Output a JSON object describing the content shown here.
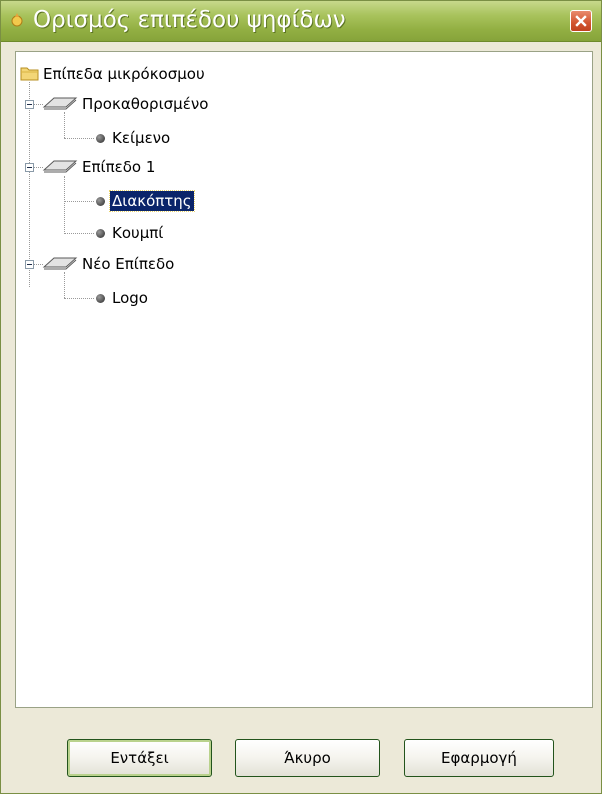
{
  "window": {
    "title": "Ορισμός επιπέδου ψηφίδων",
    "accent": "#93b043"
  },
  "tree": {
    "root": {
      "label": "Επίπεδα μικρόκοσμου",
      "icon": "folder-icon"
    },
    "layers": [
      {
        "label": "Προκαθορισμένο",
        "icon": "layer-icon",
        "expanded": true,
        "children": [
          {
            "label": "Κείμενο"
          }
        ]
      },
      {
        "label": "Επίπεδο 1",
        "icon": "layer-icon",
        "expanded": true,
        "children": [
          {
            "label": "Διακόπτης",
            "selected": true
          },
          {
            "label": "Κουμπί"
          }
        ]
      },
      {
        "label": "Νέο Επίπεδο",
        "icon": "layer-icon",
        "expanded": true,
        "children": [
          {
            "label": "Logo"
          }
        ]
      }
    ]
  },
  "buttons": {
    "ok": "Εντάξει",
    "cancel": "Άκυρο",
    "apply": "Εφαρμογή"
  }
}
